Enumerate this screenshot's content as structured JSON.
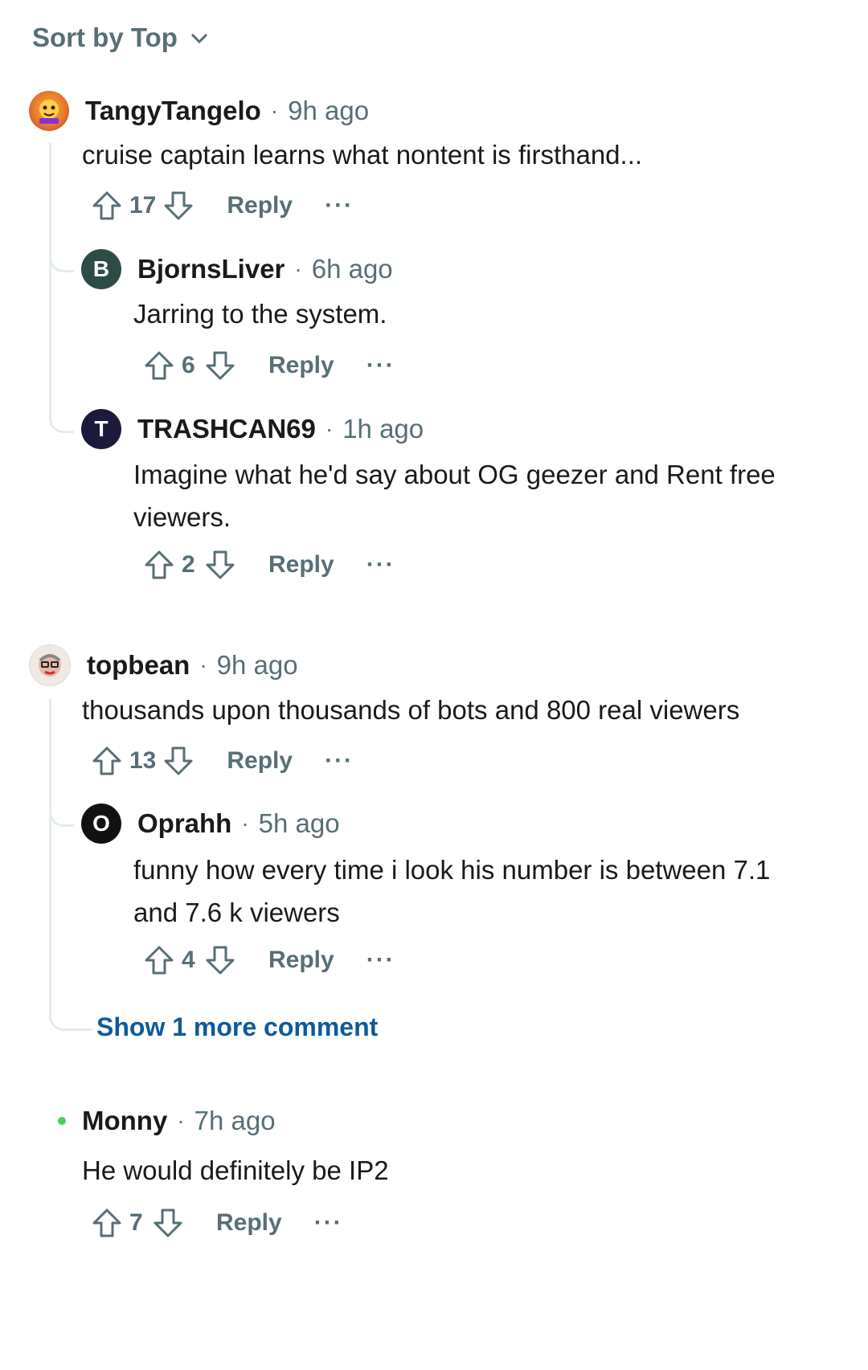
{
  "sort": {
    "label": "Sort by Top"
  },
  "comments": [
    {
      "user": "TangyTangelo",
      "time": "9h ago",
      "text": "cruise captain learns what nontent is firsthand...",
      "votes": "17",
      "reply": "Reply",
      "more": "···"
    },
    {
      "user": "BjornsLiver",
      "avatar_letter": "B",
      "avatar_color": "#2c4c46",
      "time": "6h ago",
      "text": "Jarring to the system.",
      "votes": "6",
      "reply": "Reply",
      "more": "···"
    },
    {
      "user": "TRASHCAN69",
      "avatar_letter": "T",
      "avatar_color": "#1c1a3d",
      "time": "1h ago",
      "text": "Imagine what he'd say about OG geezer and Rent free viewers.",
      "votes": "2",
      "reply": "Reply",
      "more": "···"
    },
    {
      "user": "topbean",
      "time": "9h ago",
      "text": "thousands upon thousands of bots and 800 real viewers",
      "votes": "13",
      "reply": "Reply",
      "more": "···"
    },
    {
      "user": "Oprahh",
      "avatar_letter": "O",
      "avatar_color": "#111111",
      "time": "5h ago",
      "text": "funny how every time i look his number is between 7.1 and 7.6 k viewers",
      "votes": "4",
      "reply": "Reply",
      "more": "···"
    },
    {
      "user": "Monny",
      "time": "7h ago",
      "text": "He would definitely be IP2",
      "votes": "7",
      "reply": "Reply",
      "more": "···"
    }
  ],
  "show_more": "Show 1 more comment",
  "colors": {
    "accent_link": "#0e5a9c",
    "meta": "#576f76",
    "thread_line": "#e5ebee",
    "online": "#46d160"
  },
  "icons": [
    "chevron-down-icon",
    "upvote-icon",
    "downvote-icon",
    "avatar-image",
    "online-dot-icon"
  ]
}
